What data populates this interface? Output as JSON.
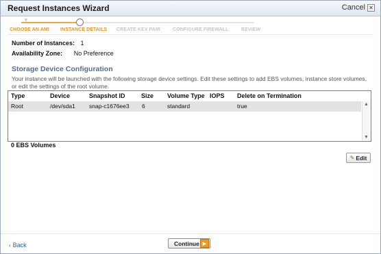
{
  "window": {
    "title": "Request Instances Wizard",
    "cancel_label": "Cancel",
    "close_icon": "close-icon"
  },
  "steps": [
    {
      "label": "CHOOSE AN AMI",
      "state": "done"
    },
    {
      "label": "INSTANCE DETAILS",
      "state": "current"
    },
    {
      "label": "CREATE KEY PAIR",
      "state": "upcoming"
    },
    {
      "label": "CONFIGURE FIREWALL",
      "state": "upcoming"
    },
    {
      "label": "REVIEW",
      "state": "upcoming"
    }
  ],
  "details": {
    "num_instances_label": "Number of Instances:",
    "num_instances_value": "1",
    "availability_zone_label": "Availability Zone:",
    "availability_zone_value": "No Preference"
  },
  "storage": {
    "title": "Storage Device Configuration",
    "description": "Your instance will be launched with the following storage device settings. Edit these settings to add EBS volumes, instance store volumes, or edit the settings of the root volume.",
    "columns": [
      "Type",
      "Device",
      "Snapshot ID",
      "Size",
      "Volume Type",
      "IOPS",
      "Delete on Termination"
    ],
    "rows": [
      {
        "type": "Root",
        "device": "/dev/sda1",
        "snapshot_id": "snap-c1676ee3",
        "size": "6",
        "volume_type": "standard",
        "iops": "",
        "delete_on_termination": "true"
      }
    ],
    "ebs_count_label": "0 EBS Volumes",
    "edit_label": "Edit"
  },
  "footer": {
    "back_label": "Back",
    "continue_label": "Continue"
  },
  "colors": {
    "accent_orange": "#f29a1f",
    "section_title": "#4d6f99",
    "link": "#2a5a93"
  }
}
